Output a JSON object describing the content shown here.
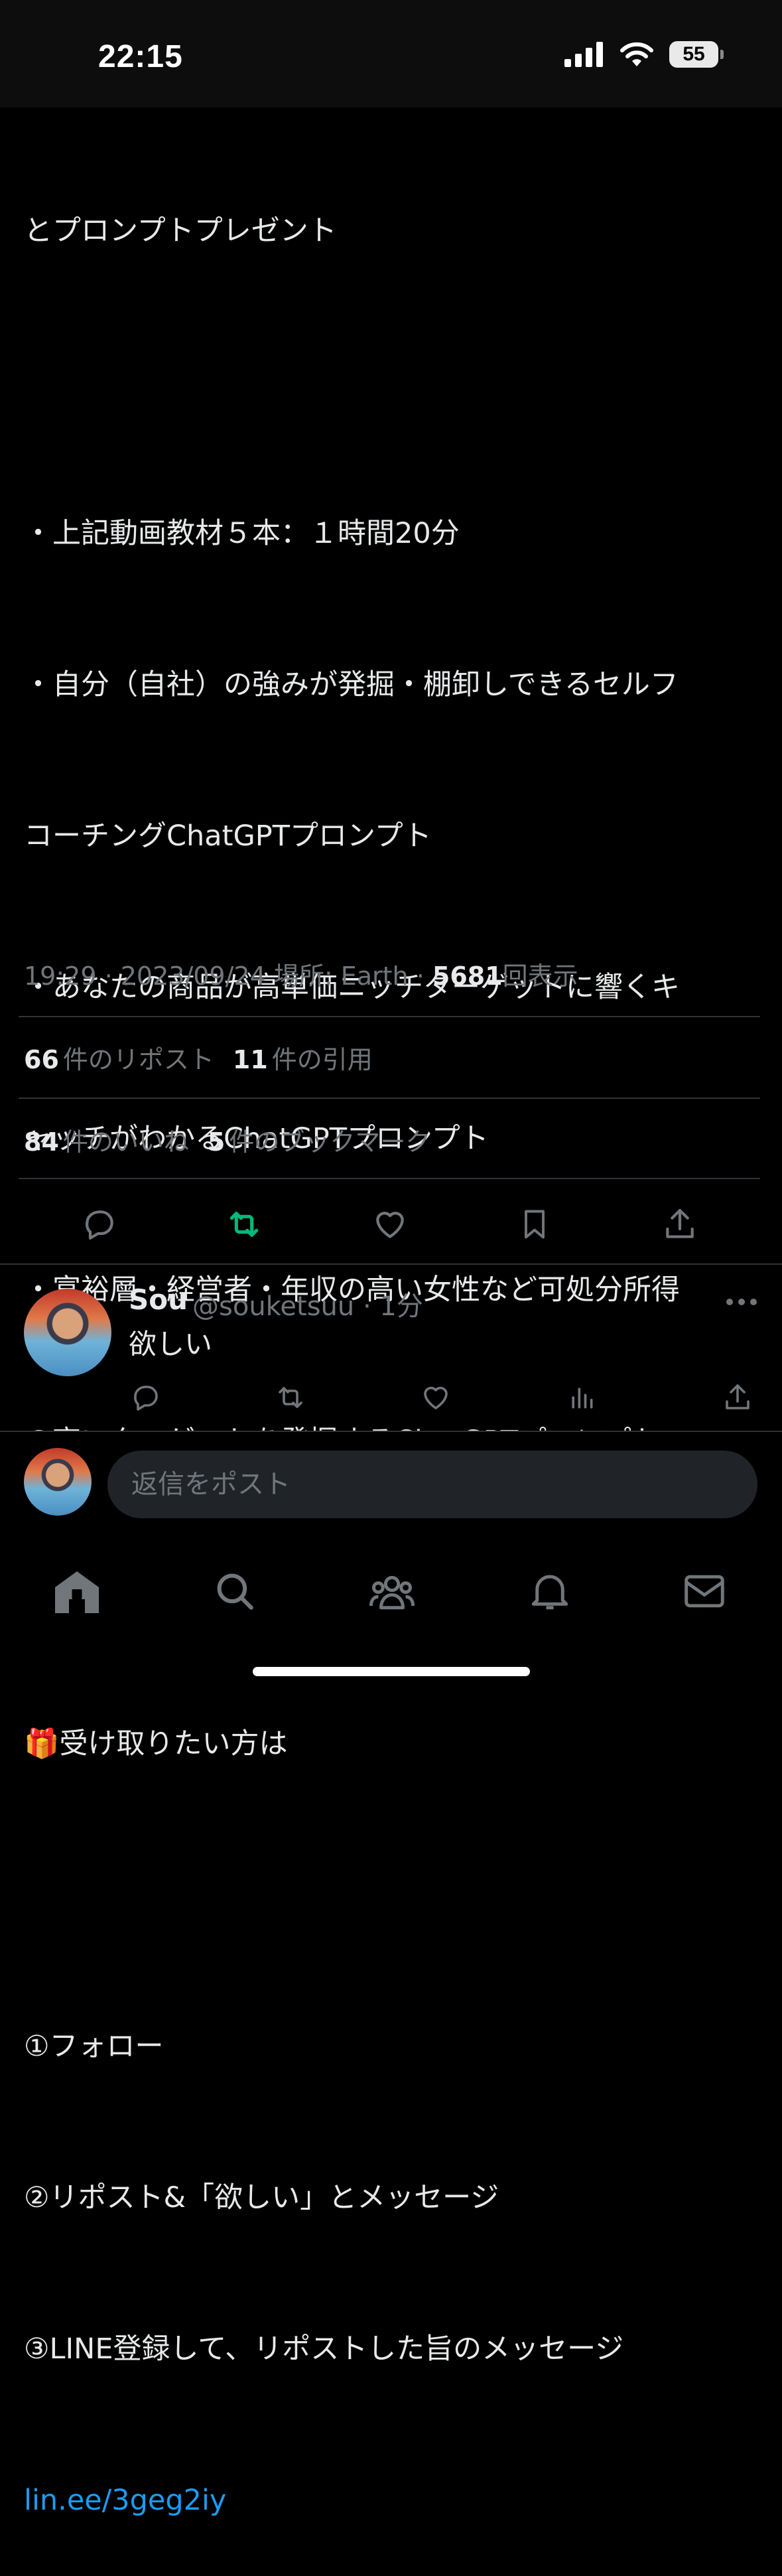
{
  "status_bar": {
    "time": "22:15",
    "battery": "55"
  },
  "tweet": {
    "body_lines": [
      "とプロンプトプレゼント",
      "",
      "・上記動画教材５本：１時間20分",
      "・自分（自社）の強みが発掘・棚卸しできるセルフ",
      "コーチングChatGPTプロンプト",
      "・あなたの商品が高単価ニッチターゲットに響くキ",
      "ャッチがわかるChatGPTプロンプト",
      "・富裕層・経営者・年収の高い女性など可処分所得",
      "の高いターゲットを発掘するChatGPTプロンプト",
      "",
      "🎁受け取りたい方は",
      "",
      "①フォロー",
      "②リポスト&「欲しい」とメッセージ",
      "③LINE登録して、リポストした旨のメッセージ"
    ],
    "link": "lin.ee/3geg2iy",
    "meta": {
      "time_date": "19:29 · 2023/09/24 場所: Earth · ",
      "views_count": "5681",
      "views_label": "回表示"
    },
    "stats": {
      "reposts_count": "66",
      "reposts_label": "件のリポスト",
      "quotes_count": "11",
      "quotes_label": "件の引用",
      "likes_count": "84",
      "likes_label": "件のいいね",
      "bookmarks_count": "5",
      "bookmarks_label": "件のブックマーク"
    },
    "colors": {
      "repost_active": "#00ba7c",
      "link": "#1d9bf0",
      "muted": "#71767b"
    }
  },
  "reply": {
    "name": "Sou",
    "handle": "@souketsuu · 1分",
    "text": "欲しい"
  },
  "compose": {
    "placeholder": "返信をポスト"
  },
  "tabs": [
    "home-icon",
    "search-icon",
    "communities-icon",
    "notifications-icon",
    "messages-icon"
  ]
}
